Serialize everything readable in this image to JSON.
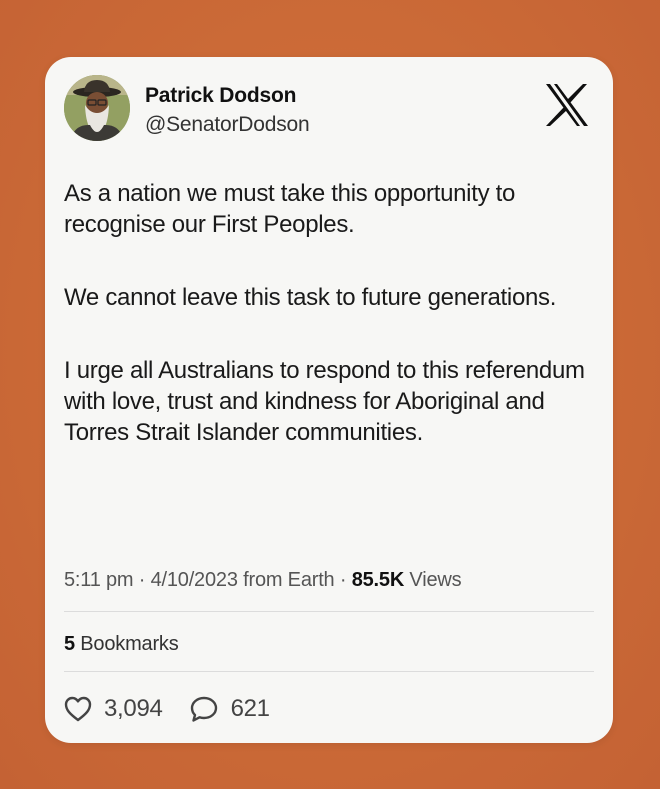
{
  "author": {
    "display_name": "Patrick Dodson",
    "handle": "@SenatorDodson"
  },
  "brand": {
    "logo_icon": "x-logo-icon"
  },
  "tweet": {
    "paragraphs": [
      "As a nation we must take this opportunity to recognise our First Peoples.",
      "We cannot leave this task to future generations.",
      "I urge all Australians to respond to this referendum with love, trust and kindness for Aboriginal and Torres Strait Islander communities."
    ],
    "time": "5:11 pm",
    "date": "4/10/2023",
    "source": "from Earth",
    "views_count": "85.5K",
    "views_label": "Views"
  },
  "engagement": {
    "bookmarks_count": "5",
    "bookmarks_label": "Bookmarks",
    "likes": "3,094",
    "replies": "621",
    "like_icon": "heart-icon",
    "reply_icon": "speech-bubble-icon"
  },
  "colors": {
    "background": "#cb6a37",
    "card": "#f7f7f5",
    "text": "#1a1a1a"
  }
}
